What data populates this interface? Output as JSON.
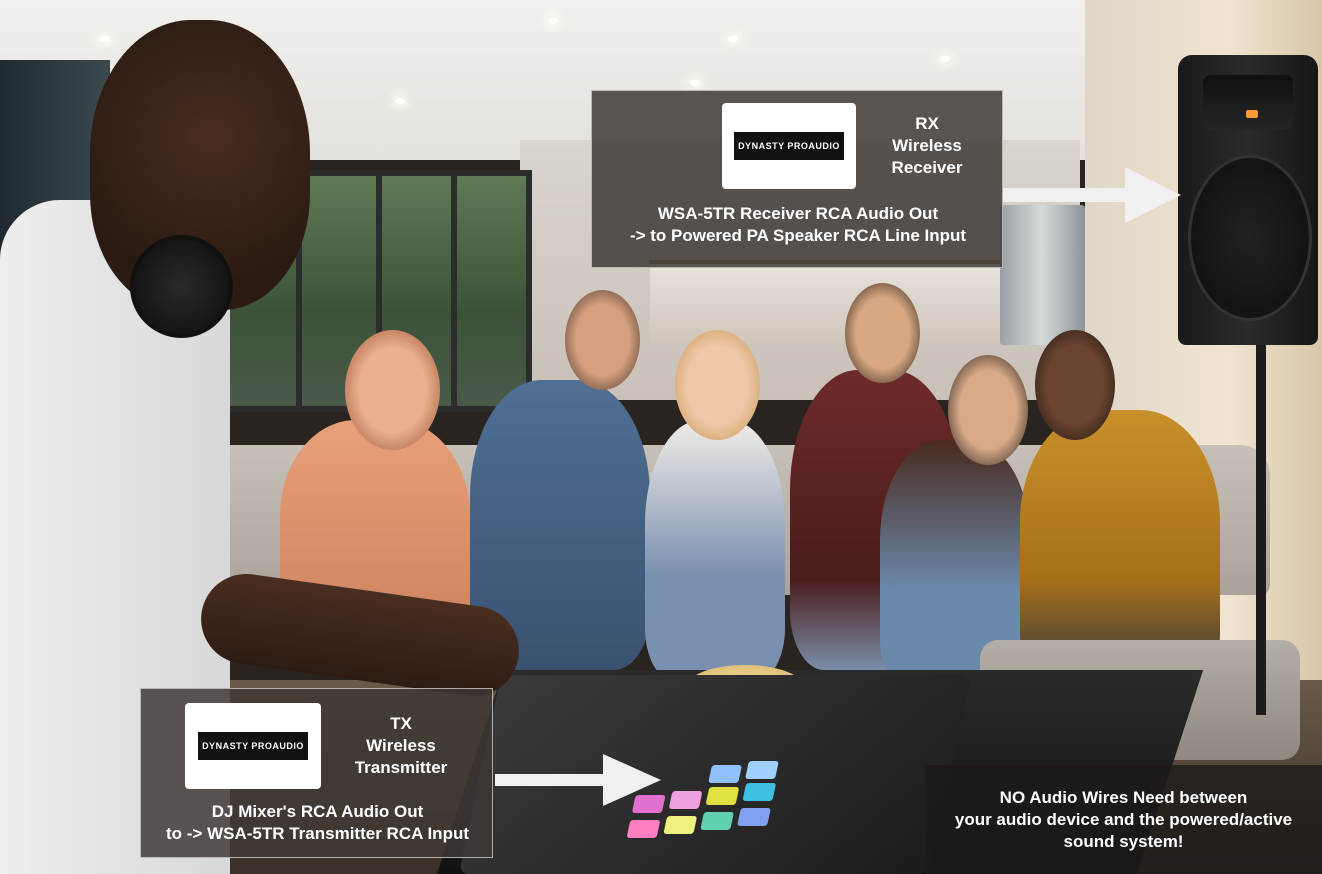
{
  "rx_panel": {
    "logo_text": "DYNASTY PROAUDIO",
    "title_lines": [
      "RX",
      "Wireless",
      "Receiver"
    ],
    "body_lines": [
      "WSA-5TR Receiver RCA Audio Out",
      "-> to Powered PA Speaker RCA Line Input"
    ]
  },
  "tx_panel": {
    "logo_text": "DYNASTY PROAUDIO",
    "title_lines": [
      "TX",
      "Wireless",
      "Transmitter"
    ],
    "body_lines": [
      "DJ Mixer's RCA Audio Out",
      "to -> WSA-5TR Transmitter RCA Input"
    ]
  },
  "note": {
    "lines": [
      "NO Audio Wires Need between",
      "your audio device and the powered/active",
      "sound system!"
    ]
  },
  "colors": {
    "panel_bg": "#3e3834",
    "text": "#ffffff",
    "arrow": "#f0f0f0"
  }
}
